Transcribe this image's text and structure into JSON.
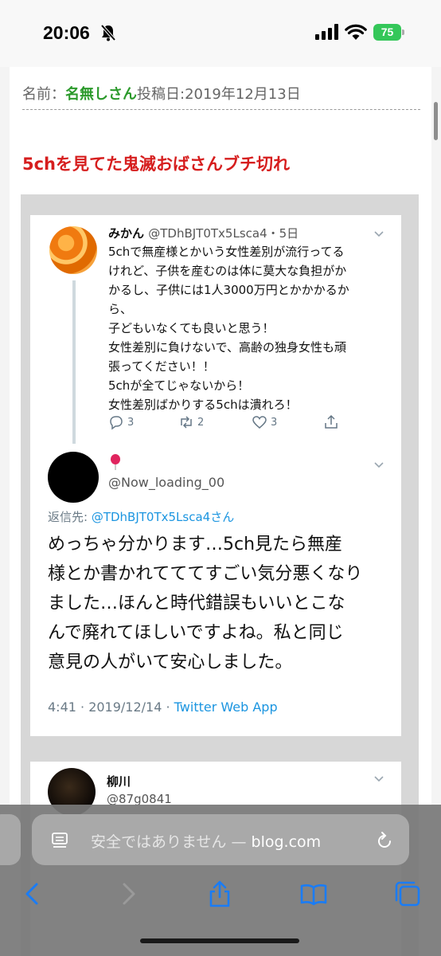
{
  "status_bar": {
    "time": "20:06",
    "battery": "75",
    "icons": [
      "bell-slash-icon",
      "cellular-signal-icon",
      "wifi-icon",
      "battery-icon"
    ]
  },
  "post": {
    "name_label": "名前：",
    "name_value": "名無しさん",
    "date_label": "投稿日:",
    "date_value": "2019年12月13日",
    "title": "5chを見てた鬼滅おばさんブチ切れ"
  },
  "tweet1": {
    "name": "みかん",
    "handle_date": "@TDhBJT0Tx5Lsca4・5日",
    "lines": [
      "5chで無産様とかいう女性差別が流行ってる",
      "けれど、子供を産むのは体に莫大な負担がか",
      "かるし、子供には1人3000万円とかかかるか",
      "ら、",
      "子どもいなくても良いと思う！",
      "女性差別に負けないで、高齢の独身女性も頑",
      "張ってください！！",
      "5chが全てじゃないから！",
      "女性差別ばかりする5chは潰れろ！"
    ],
    "reply_count": "3",
    "retweet_count": "2",
    "like_count": "3"
  },
  "tweet2": {
    "handle": "@Now_loading_00",
    "reply_to_label": "返信先: ",
    "reply_to_handle": "@TDhBJT0Tx5Lsca4さん",
    "lines": [
      "めっちゃ分かります…5ch見たら無産",
      "様とか書かれてててすごい気分悪くなり",
      "ました…ほんと時代錯誤もいいとこな",
      "んで廃れてほしいですよね。私と同じ",
      "意見の人がいて安心しました。"
    ],
    "timestamp": "4:41 · 2019/12/14 · ",
    "source": "Twitter Web App"
  },
  "tweet3": {
    "name": "柳川",
    "handle": "@87g0841"
  },
  "browser": {
    "address_insecure": "安全ではありません — ",
    "address_host": "blog.com",
    "icons": [
      "reader-icon",
      "reload-icon",
      "back-icon",
      "forward-icon",
      "share-icon",
      "bookmarks-icon",
      "tabs-icon"
    ]
  }
}
